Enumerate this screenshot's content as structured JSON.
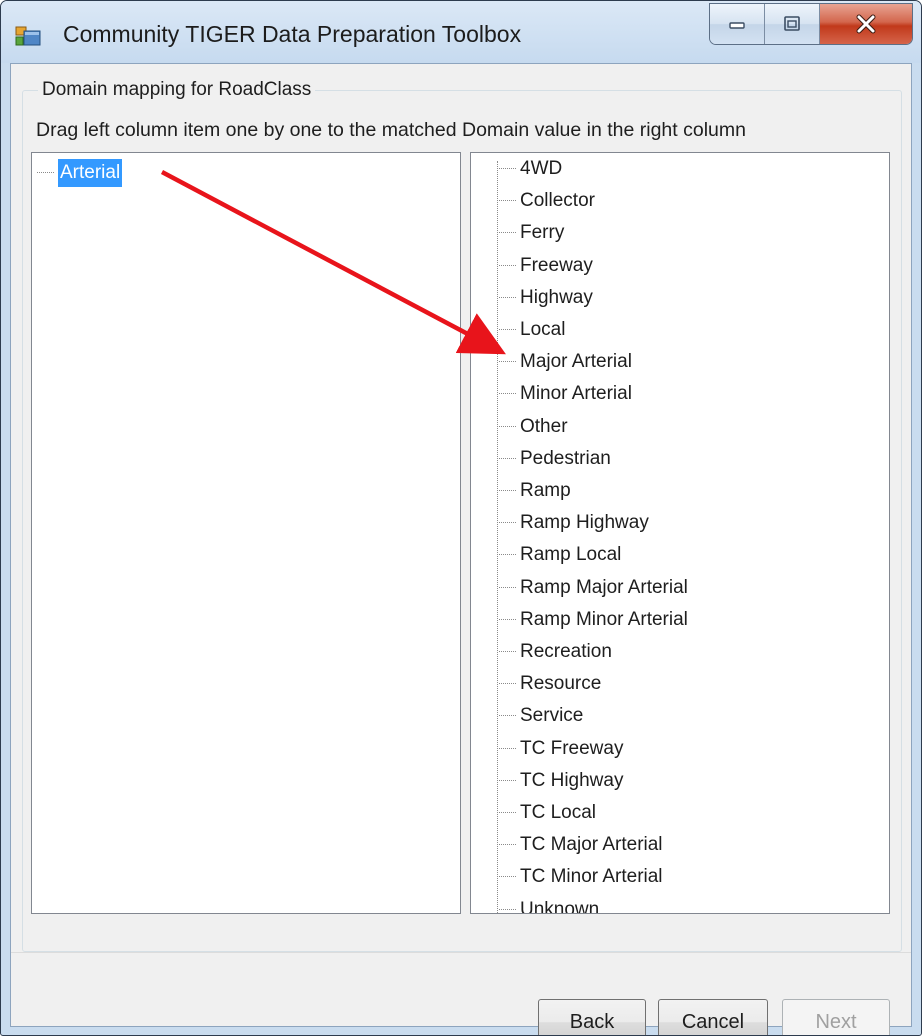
{
  "window": {
    "title": "Community TIGER Data Preparation Toolbox",
    "icon": "app-window-icon"
  },
  "caption_buttons": {
    "minimize_icon": "minimize-icon",
    "maximize_icon": "maximize-icon",
    "close_icon": "close-icon"
  },
  "group": {
    "legend": "Domain mapping for RoadClass",
    "instructions": "Drag left column item one by one to the matched Domain value in the right column"
  },
  "left_tree": {
    "items": [
      {
        "label": "Arterial",
        "selected": true
      }
    ]
  },
  "right_tree": {
    "items": [
      {
        "label": "4WD"
      },
      {
        "label": "Collector"
      },
      {
        "label": "Ferry"
      },
      {
        "label": "Freeway"
      },
      {
        "label": "Highway"
      },
      {
        "label": "Local"
      },
      {
        "label": "Major Arterial"
      },
      {
        "label": "Minor Arterial"
      },
      {
        "label": "Other"
      },
      {
        "label": "Pedestrian"
      },
      {
        "label": "Ramp"
      },
      {
        "label": "Ramp Highway"
      },
      {
        "label": "Ramp Local"
      },
      {
        "label": "Ramp Major Arterial"
      },
      {
        "label": "Ramp Minor Arterial"
      },
      {
        "label": "Recreation"
      },
      {
        "label": "Resource"
      },
      {
        "label": "Service"
      },
      {
        "label": "TC Freeway"
      },
      {
        "label": "TC Highway"
      },
      {
        "label": "TC Local"
      },
      {
        "label": "TC Major Arterial"
      },
      {
        "label": "TC Minor Arterial"
      },
      {
        "label": "Unknown"
      }
    ]
  },
  "buttons": {
    "back": "Back",
    "cancel": "Cancel",
    "next": "Next",
    "next_enabled": false
  },
  "annotation": {
    "type": "drag-arrow",
    "from_item": "Arterial",
    "to_item": "Major Arterial",
    "color": "#e8141b"
  },
  "colors": {
    "selection": "#3399ff",
    "frame": "#c9dcef",
    "close_button": "#c8452a"
  }
}
